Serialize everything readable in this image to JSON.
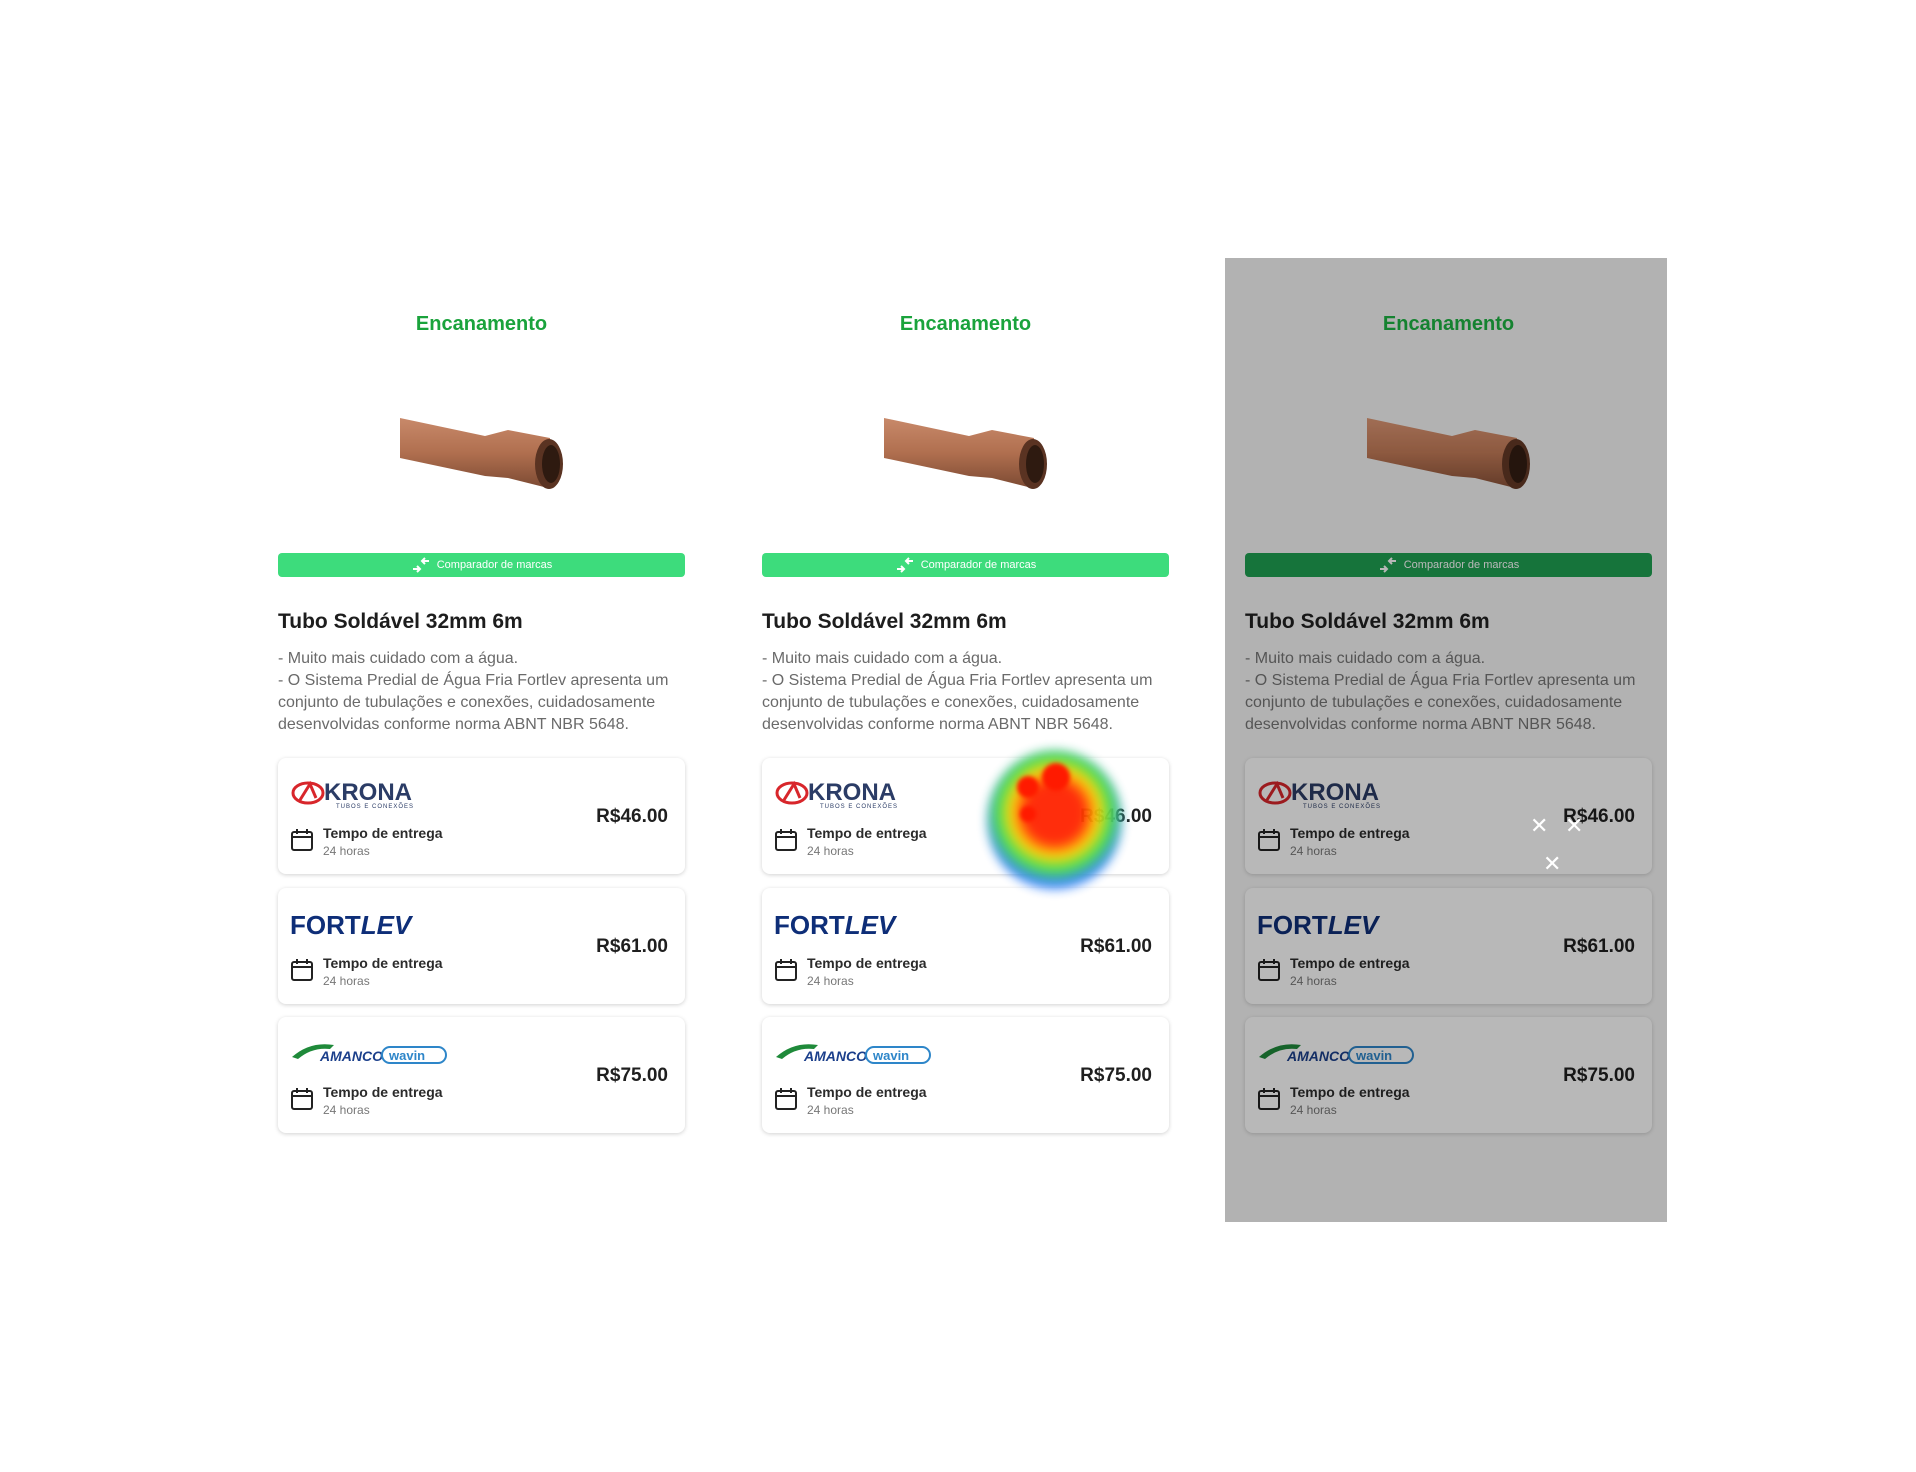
{
  "panels": [
    {
      "category": "Encanamento",
      "compare_label": "Comparador de marcas",
      "title": "Tubo Soldável 32mm 6m",
      "description": [
        "- Muito mais cuidado com a água.",
        "- O Sistema Predial de Água Fria Fortlev apresenta um conjunto de tubulações e conexões, cuidadosamente desenvolvidas conforme norma ABNT NBR 5648."
      ],
      "offers": [
        {
          "brand": "KRONA",
          "brand_sub": "TUBOS E CONEXÕES",
          "delivery_label": "Tempo de entrega",
          "delivery_time": "24 horas",
          "price": "R$46.00"
        },
        {
          "brand": "FORTLEV",
          "delivery_label": "Tempo de entrega",
          "delivery_time": "24 horas",
          "price": "R$61.00"
        },
        {
          "brand": "AMANCO wavin",
          "delivery_label": "Tempo de entrega",
          "delivery_time": "24 horas",
          "price": "R$75.00"
        }
      ]
    },
    {
      "category": "Encanamento",
      "compare_label": "Comparador de marcas",
      "title": "Tubo Soldável 32mm 6m",
      "description": [
        "- Muito mais cuidado com a água.",
        "- O Sistema Predial de Água Fria Fortlev apresenta um conjunto de tubulações e conexões, cuidadosamente desenvolvidas conforme norma ABNT NBR 5648."
      ],
      "offers": [
        {
          "brand": "KRONA",
          "brand_sub": "TUBOS E CONEXÕES",
          "delivery_label": "Tempo de entrega",
          "delivery_time": "24 horas",
          "price": "R$46.00"
        },
        {
          "brand": "FORTLEV",
          "delivery_label": "Tempo de entrega",
          "delivery_time": "24 horas",
          "price": "R$61.00"
        },
        {
          "brand": "AMANCO wavin",
          "delivery_label": "Tempo de entrega",
          "delivery_time": "24 horas",
          "price": "R$75.00"
        }
      ]
    },
    {
      "category": "Encanamento",
      "compare_label": "Comparador de marcas",
      "title": "Tubo Soldável 32mm 6m",
      "description": [
        "- Muito mais cuidado com a água.",
        "- O Sistema Predial de Água Fria Fortlev apresenta um conjunto de tubulações e conexões, cuidadosamente desenvolvidas conforme norma ABNT NBR 5648."
      ],
      "offers": [
        {
          "brand": "KRONA",
          "brand_sub": "TUBOS E CONEXÕES",
          "delivery_label": "Tempo de entrega",
          "delivery_time": "24 horas",
          "price": "R$46.00"
        },
        {
          "brand": "FORTLEV",
          "delivery_label": "Tempo de entrega",
          "delivery_time": "24 horas",
          "price": "R$61.00"
        },
        {
          "brand": "AMANCO wavin",
          "delivery_label": "Tempo de entrega",
          "delivery_time": "24 horas",
          "price": "R$75.00"
        }
      ]
    }
  ],
  "colors": {
    "category": "#1aa33c",
    "compare_bar": "#3ddc7c",
    "compare_bar_dark": "#1fa152"
  }
}
